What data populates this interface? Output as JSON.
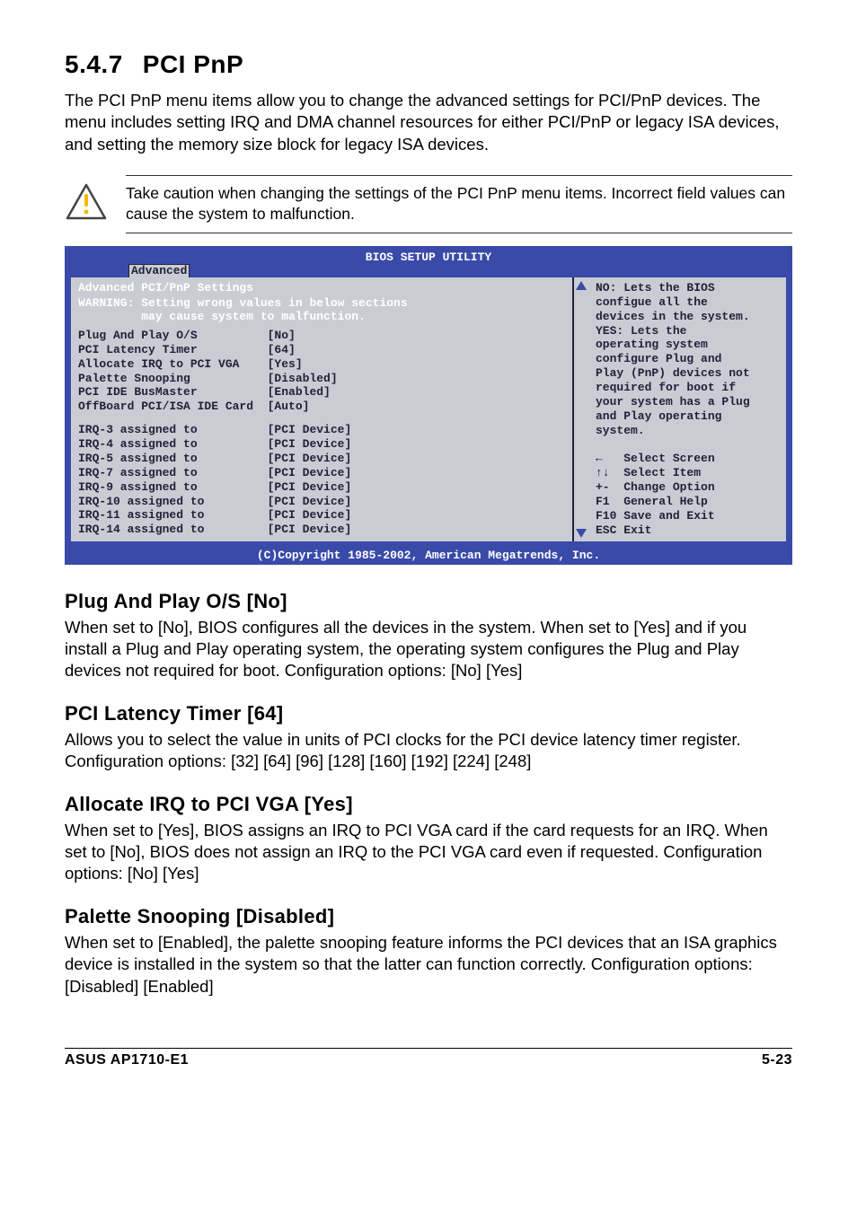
{
  "section": {
    "number": "5.4.7",
    "title": "PCI PnP"
  },
  "intro": "The PCI PnP menu items allow you to change the advanced settings for PCI/PnP devices. The menu includes setting IRQ and DMA channel resources for either PCI/PnP or legacy ISA devices, and setting the memory size block for legacy ISA devices.",
  "caution": "Take caution when changing the settings of the PCI PnP menu items. Incorrect field values can cause the system to malfunction.",
  "bios": {
    "title": "BIOS SETUP UTILITY",
    "tab": "Advanced",
    "heading": "Advanced PCI/PnP Settings",
    "warning": "WARNING: Setting wrong values in below sections\n         may cause system to malfunction.",
    "settings_block1": "Plug And Play O/S          [No]\nPCI Latency Timer          [64]\nAllocate IRQ to PCI VGA    [Yes]\nPalette Snooping           [Disabled]\nPCI IDE BusMaster          [Enabled]\nOffBoard PCI/ISA IDE Card  [Auto]",
    "settings_block2": "IRQ-3 assigned to          [PCI Device]\nIRQ-4 assigned to          [PCI Device]\nIRQ-5 assigned to          [PCI Device]\nIRQ-7 assigned to          [PCI Device]\nIRQ-9 assigned to          [PCI Device]\nIRQ-10 assigned to         [PCI Device]\nIRQ-11 assigned to         [PCI Device]\nIRQ-14 assigned to         [PCI Device]",
    "help": "NO: Lets the BIOS\nconfigue all the\ndevices in the system.\nYES: Lets the\noperating system\nconfigure Plug and\nPlay (PnP) devices not\nrequired for boot if\nyour system has a Plug\nand Play operating\nsystem.\n\n←   Select Screen\n↑↓  Select Item\n+-  Change Option\nF1  General Help\nF10 Save and Exit\nESC Exit",
    "copyright": "(C)Copyright 1985-2002, American Megatrends, Inc."
  },
  "options": [
    {
      "title": "Plug And Play O/S [No]",
      "desc": "When set to [No], BIOS configures all the devices in the system. When set to [Yes] and if you install a Plug and Play operating system, the operating system configures the Plug and Play devices not required for boot. Configuration options: [No] [Yes]"
    },
    {
      "title": "PCI Latency Timer [64]",
      "desc": "Allows you to select the value in units of PCI clocks for the PCI device latency timer register. Configuration options: [32] [64] [96] [128] [160] [192] [224] [248]"
    },
    {
      "title": "Allocate IRQ to PCI VGA [Yes]",
      "desc": "When set to [Yes], BIOS assigns an IRQ to PCI VGA card if the card requests for an IRQ. When set to [No], BIOS does not assign an IRQ to the PCI VGA card even if requested. Configuration options: [No] [Yes]"
    },
    {
      "title": "Palette Snooping [Disabled]",
      "desc": "When set to [Enabled], the palette snooping feature informs the PCI devices that an ISA graphics device is installed in the system so that the latter can function correctly. Configuration options: [Disabled] [Enabled]"
    }
  ],
  "footer": {
    "left": "ASUS AP1710-E1",
    "right": "5-23"
  }
}
